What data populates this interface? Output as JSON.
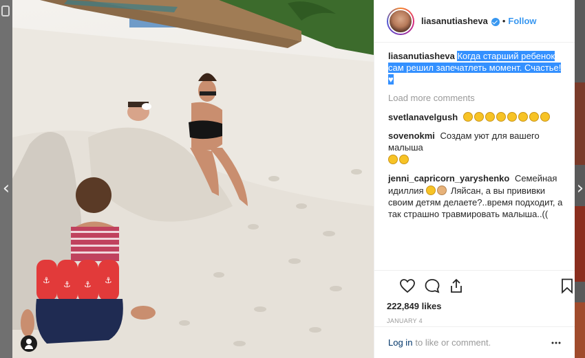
{
  "post": {
    "username": "liasanutiasheva",
    "follow_label": "Follow",
    "separator": "•",
    "caption_user": "liasanutiasheva",
    "caption_text": "Когда старший ребенок сам решил запечатлеть момент. Счастье!",
    "load_more": "Load more comments",
    "likes": "222,849 likes",
    "date": "JANUARY 4"
  },
  "comments": [
    {
      "user": "svetlanavelgush",
      "text": "",
      "emoji_count": 8
    },
    {
      "user": "sovenokmi",
      "text": "Создам уют для вашего малыша",
      "emoji_count": 2
    },
    {
      "user": "jenni_capricorn_yaryshenko",
      "text_before": "Семейная идиллия",
      "text_after": "Ляйсан, а вы прививки своим детям делаете?..время подходит, а так страшно травмировать малыша..(("
    }
  ],
  "footer": {
    "login_link": "Log in",
    "login_rest": "to like or comment."
  },
  "icons": {
    "like": "heart-outline-icon",
    "comment": "speech-bubble-icon",
    "share": "share-upload-icon",
    "save": "bookmark-icon",
    "more": "ellipsis-icon"
  },
  "colors": {
    "link_blue": "#3897f0",
    "selection": "#3390ff",
    "verified": "#3897f0",
    "text": "#262626",
    "muted": "#999999"
  }
}
